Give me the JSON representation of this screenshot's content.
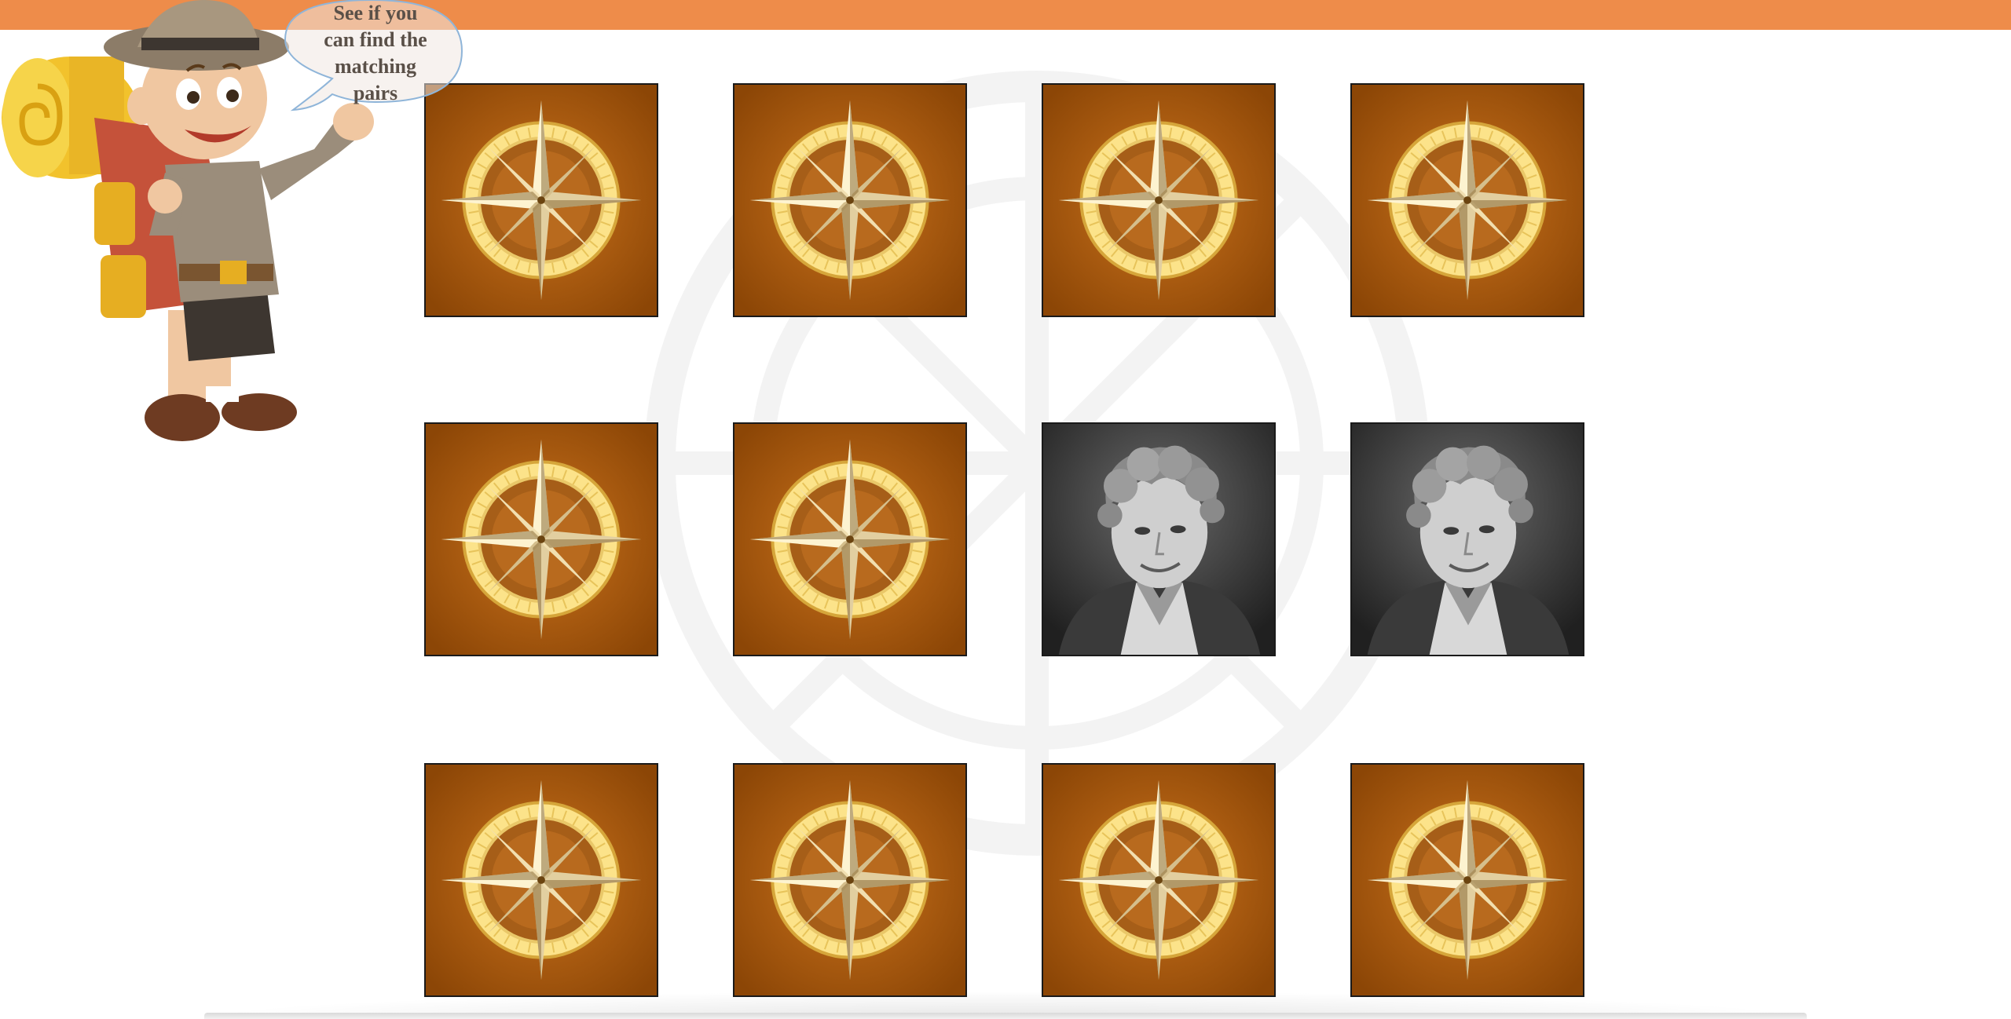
{
  "header": {
    "bar_color": "#ee8c4a"
  },
  "mascot": {
    "speech": [
      "See if you",
      "can find the",
      "matching",
      "pairs"
    ],
    "icon": "explorer-boy-with-backpack"
  },
  "board": {
    "rows": 3,
    "columns": 4,
    "card_back_icon": "compass-rose-icon",
    "card_back_color": "#8c4606",
    "revealed_face_icon": "portrait-photo",
    "cards": [
      {
        "state": "face-down"
      },
      {
        "state": "face-down"
      },
      {
        "state": "face-down"
      },
      {
        "state": "face-down"
      },
      {
        "state": "face-down"
      },
      {
        "state": "face-down"
      },
      {
        "state": "face-up"
      },
      {
        "state": "face-up"
      },
      {
        "state": "face-down"
      },
      {
        "state": "face-down"
      },
      {
        "state": "face-down"
      },
      {
        "state": "face-down"
      }
    ]
  }
}
